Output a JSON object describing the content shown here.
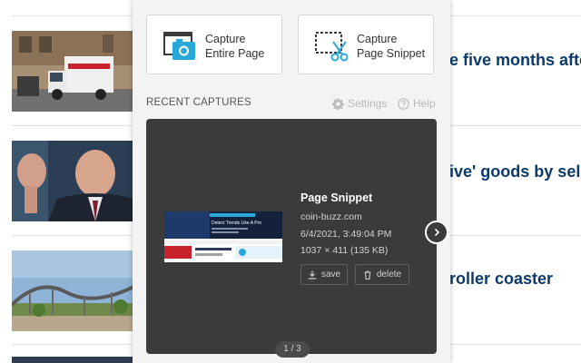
{
  "background_page": {
    "headlines": [
      "e five months after",
      "ive' goods by sellin",
      "roller coaster"
    ]
  },
  "popup": {
    "capture_entire": {
      "line1": "Capture",
      "line2": "Entire Page",
      "icon": "camera-browser-icon"
    },
    "capture_snippet": {
      "line1": "Capture",
      "line2": "Page Snippet",
      "icon": "scissors-selection-icon"
    },
    "section_title": "RECENT CAPTURES",
    "settings_label": "Settings",
    "help_label": "Help",
    "capture": {
      "title": "Page Snippet",
      "site": "coin-buzz.com",
      "datetime": "6/4/2021, 3:49:04 PM",
      "size": "1037 × 411 (135 KB)",
      "save_label": "save",
      "delete_label": "delete",
      "preview_text": "Detect Trends Like A Pro"
    },
    "pager": "1 / 3"
  },
  "colors": {
    "headline": "#0b3a6b",
    "accent_blue": "#2aa8d8",
    "card_bg": "#3b3b3b",
    "popup_bg": "#f3f3f3"
  }
}
